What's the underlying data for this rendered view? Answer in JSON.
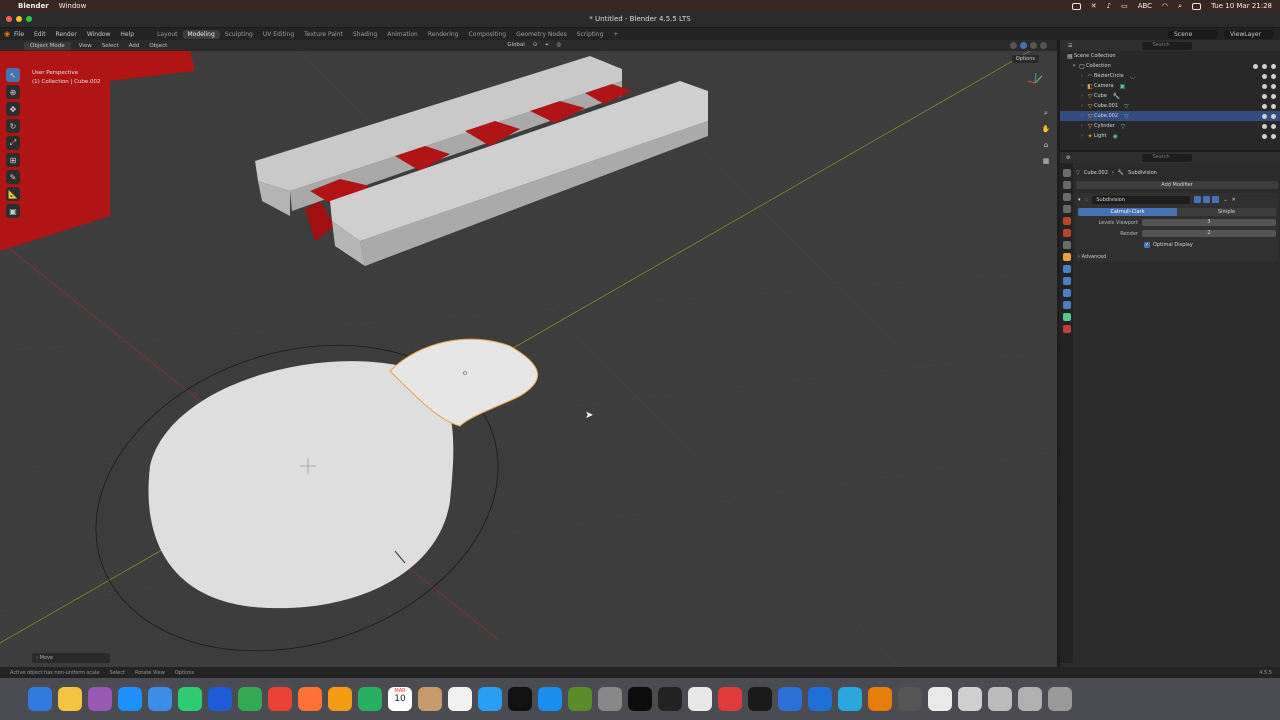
{
  "menubar": {
    "app_name": "Blender",
    "items": [
      "Window"
    ],
    "datetime": "Tue 10 Mar  21:28",
    "input_source": "ABC"
  },
  "window": {
    "title": "* Untitled - Blender 4.5.5 LTS"
  },
  "topbar": {
    "menus": [
      "File",
      "Edit",
      "Render",
      "Window",
      "Help"
    ],
    "workspaces": [
      "Layout",
      "Modeling",
      "Sculpting",
      "UV Editing",
      "Texture Paint",
      "Shading",
      "Animation",
      "Rendering",
      "Compositing",
      "Geometry Nodes",
      "Scripting"
    ],
    "active_workspace": "Modeling",
    "add_tab": "+",
    "scene": "Scene",
    "view_layer": "ViewLayer"
  },
  "viewport_header": {
    "mode": "Object Mode",
    "menus": [
      "View",
      "Select",
      "Add",
      "Object"
    ],
    "orientation": "Global"
  },
  "viewport": {
    "perspective": "User Perspective",
    "collection_info": "(1) Collection | Cube.002",
    "options": "Options",
    "last_operation": "Move"
  },
  "outliner": {
    "root": "Scene Collection",
    "collection": "Collection",
    "search_placeholder": "Search",
    "items": [
      {
        "name": "BézierCircle",
        "selected": false
      },
      {
        "name": "Camera",
        "selected": false
      },
      {
        "name": "Cube",
        "selected": false
      },
      {
        "name": "Cube.001",
        "selected": false
      },
      {
        "name": "Cube.002",
        "selected": true
      },
      {
        "name": "Cylinder",
        "selected": false
      },
      {
        "name": "Light",
        "selected": false
      }
    ]
  },
  "properties": {
    "search_placeholder": "Search",
    "breadcrumb_object": "Cube.002",
    "breadcrumb_modifier": "Subdivision",
    "add_modifier": "Add Modifier",
    "modifier_name": "Subdivision",
    "algorithm_options": [
      "Catmull-Clark",
      "Simple"
    ],
    "active_algorithm": "Catmull-Clark",
    "levels_viewport_label": "Levels Viewport",
    "levels_viewport": "3",
    "render_label": "Render",
    "render_level": "2",
    "optimal_display": "Optimal Display",
    "advanced": "Advanced"
  },
  "statusbar": {
    "info": "Active object has non-uniform scale",
    "select": "Select",
    "rotate_view": "Rotate View",
    "options": "Options",
    "version": "4.5.5"
  },
  "dock": {
    "calendar_day": "10",
    "calendar_month": "MAR"
  }
}
